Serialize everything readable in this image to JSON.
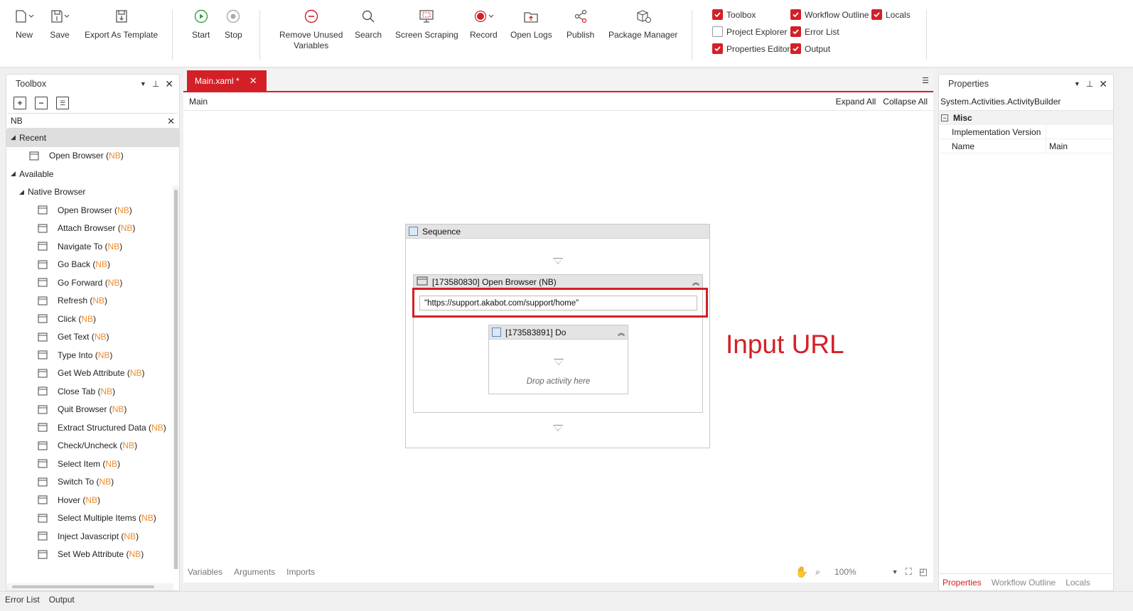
{
  "ribbon": {
    "buttons": [
      {
        "label": "New",
        "icon": "new-file-icon"
      },
      {
        "label": "Save",
        "icon": "save-icon"
      },
      {
        "label": "Export As Template",
        "icon": "export-template-icon"
      },
      {
        "label": "Start",
        "icon": "play-icon"
      },
      {
        "label": "Stop",
        "icon": "stop-icon"
      },
      {
        "label": "Remove Unused\nVariables",
        "icon": "minus-circle-icon"
      },
      {
        "label": "Search",
        "icon": "search-icon"
      },
      {
        "label": "Screen Scraping",
        "icon": "screen-scraping-icon"
      },
      {
        "label": "Record",
        "icon": "record-icon"
      },
      {
        "label": "Open Logs",
        "icon": "open-logs-icon"
      },
      {
        "label": "Publish",
        "icon": "publish-share-icon"
      },
      {
        "label": "Package Manager",
        "icon": "package-manager-icon"
      }
    ],
    "panels": [
      {
        "label": "Toolbox",
        "checked": true
      },
      {
        "label": "Project Explorer",
        "checked": false
      },
      {
        "label": "Properties Editor",
        "checked": true
      },
      {
        "label": "Workflow Outline",
        "checked": true
      },
      {
        "label": "Error List",
        "checked": true
      },
      {
        "label": "Output",
        "checked": true
      },
      {
        "label": "Locals",
        "checked": true
      }
    ]
  },
  "toolbox": {
    "title": "Toolbox",
    "search_value": "NB",
    "recent_label": "Recent",
    "available_label": "Available",
    "group_label": "Native Browser",
    "recent": [
      {
        "name": "Open Browser",
        "tag": "NB",
        "icon": "browser-window-icon"
      }
    ],
    "items": [
      {
        "name": "Open Browser",
        "tag": "NB",
        "icon": "browser-window-icon"
      },
      {
        "name": "Attach Browser",
        "tag": "NB",
        "icon": "attach-browser-icon"
      },
      {
        "name": "Navigate To",
        "tag": "NB",
        "icon": "navigate-icon"
      },
      {
        "name": "Go Back",
        "tag": "NB",
        "icon": "go-back-icon"
      },
      {
        "name": "Go Forward",
        "tag": "NB",
        "icon": "go-forward-icon"
      },
      {
        "name": "Refresh",
        "tag": "NB",
        "icon": "refresh-icon"
      },
      {
        "name": "Click",
        "tag": "NB",
        "icon": "click-icon"
      },
      {
        "name": "Get Text",
        "tag": "NB",
        "icon": "get-text-icon"
      },
      {
        "name": "Type Into",
        "tag": "NB",
        "icon": "type-into-icon"
      },
      {
        "name": "Get Web Attribute",
        "tag": "NB",
        "icon": "web-attribute-icon"
      },
      {
        "name": "Close Tab",
        "tag": "NB",
        "icon": "close-tab-icon"
      },
      {
        "name": "Quit Browser",
        "tag": "NB",
        "icon": "quit-browser-icon"
      },
      {
        "name": "Extract Structured Data",
        "tag": "NB",
        "icon": "database-icon"
      },
      {
        "name": "Check/Uncheck",
        "tag": "NB",
        "icon": "checkbox-icon"
      },
      {
        "name": "Select Item",
        "tag": "NB",
        "icon": "list-select-icon"
      },
      {
        "name": "Switch To",
        "tag": "NB",
        "icon": "switch-arrows-icon"
      },
      {
        "name": "Hover",
        "tag": "NB",
        "icon": "hover-icon"
      },
      {
        "name": "Select Multiple Items",
        "tag": "NB",
        "icon": "multi-select-icon"
      },
      {
        "name": "Inject Javascript",
        "tag": "NB",
        "icon": "javascript-icon"
      },
      {
        "name": "Set Web Attribute",
        "tag": "NB",
        "icon": "set-attribute-icon"
      }
    ]
  },
  "designer": {
    "tab_label": "Main.xaml *",
    "breadcrumb": "Main",
    "expand_all": "Expand All",
    "collapse_all": "Collapse All",
    "sequence_title": "Sequence",
    "open_browser_title": "[173580830] Open Browser (NB)",
    "url_value": "\"https://support.akabot.com/support/home\"",
    "do_title": "[173583891] Do",
    "drop_hint": "Drop activity here",
    "annotation": "Input URL",
    "bottom_tabs": [
      "Variables",
      "Arguments",
      "Imports"
    ],
    "zoom": "100%"
  },
  "properties": {
    "title": "Properties",
    "type_name": "System.Activities.ActivityBuilder",
    "category": "Misc",
    "rows": [
      {
        "key": "Implementation Version",
        "value": ""
      },
      {
        "key": "Name",
        "value": "Main"
      }
    ],
    "tabs": [
      "Properties",
      "Workflow Outline",
      "Locals"
    ]
  },
  "status_tabs": [
    "Error List",
    "Output"
  ],
  "colors": {
    "accent": "#d32027",
    "nb_tag": "#f08a2a"
  }
}
